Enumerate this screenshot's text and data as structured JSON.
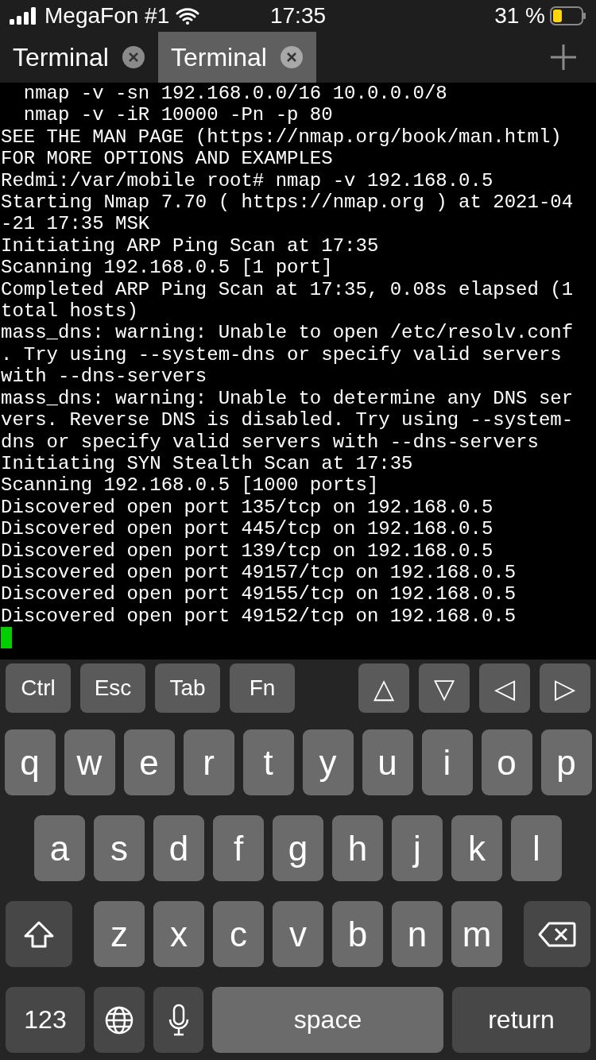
{
  "status_bar": {
    "carrier": "MegaFon #1",
    "time": "17:35",
    "battery": "31 %"
  },
  "tabs": [
    {
      "label": "Terminal",
      "selected": false
    },
    {
      "label": "Terminal",
      "selected": true
    }
  ],
  "terminal": {
    "lines": [
      "  nmap -v -sn 192.168.0.0/16 10.0.0.0/8",
      "  nmap -v -iR 10000 -Pn -p 80",
      "SEE THE MAN PAGE (https://nmap.org/book/man.html)",
      "FOR MORE OPTIONS AND EXAMPLES",
      "Redmi:/var/mobile root# nmap -v 192.168.0.5",
      "Starting Nmap 7.70 ( https://nmap.org ) at 2021-04",
      "-21 17:35 MSK",
      "Initiating ARP Ping Scan at 17:35",
      "Scanning 192.168.0.5 [1 port]",
      "Completed ARP Ping Scan at 17:35, 0.08s elapsed (1",
      "total hosts)",
      "mass_dns: warning: Unable to open /etc/resolv.conf",
      ". Try using --system-dns or specify valid servers",
      "with --dns-servers",
      "mass_dns: warning: Unable to determine any DNS ser",
      "vers. Reverse DNS is disabled. Try using --system-",
      "dns or specify valid servers with --dns-servers",
      "Initiating SYN Stealth Scan at 17:35",
      "Scanning 192.168.0.5 [1000 ports]",
      "Discovered open port 135/tcp on 192.168.0.5",
      "Discovered open port 445/tcp on 192.168.0.5",
      "Discovered open port 139/tcp on 192.168.0.5",
      "Discovered open port 49157/tcp on 192.168.0.5",
      "Discovered open port 49155/tcp on 192.168.0.5",
      "Discovered open port 49152/tcp on 192.168.0.5"
    ],
    "cursor": true
  },
  "accessory_keys": {
    "left": [
      "Ctrl",
      "Esc",
      "Tab",
      "Fn"
    ],
    "right": [
      "△",
      "▽",
      "◁",
      "▷"
    ]
  },
  "keyboard": [
    [
      {
        "kind": "letter",
        "label": "q"
      },
      {
        "kind": "letter",
        "label": "w"
      },
      {
        "kind": "letter",
        "label": "e"
      },
      {
        "kind": "letter",
        "label": "r"
      },
      {
        "kind": "letter",
        "label": "t"
      },
      {
        "kind": "letter",
        "label": "y"
      },
      {
        "kind": "letter",
        "label": "u"
      },
      {
        "kind": "letter",
        "label": "i"
      },
      {
        "kind": "letter",
        "label": "o"
      },
      {
        "kind": "letter",
        "label": "p"
      }
    ],
    [
      {
        "kind": "letter",
        "label": "a"
      },
      {
        "kind": "letter",
        "label": "s"
      },
      {
        "kind": "letter",
        "label": "d"
      },
      {
        "kind": "letter",
        "label": "f"
      },
      {
        "kind": "letter",
        "label": "g"
      },
      {
        "kind": "letter",
        "label": "h"
      },
      {
        "kind": "letter",
        "label": "j"
      },
      {
        "kind": "letter",
        "label": "k"
      },
      {
        "kind": "letter",
        "label": "l"
      }
    ],
    [
      {
        "kind": "shift"
      },
      {
        "kind": "letter",
        "label": "z"
      },
      {
        "kind": "letter",
        "label": "x"
      },
      {
        "kind": "letter",
        "label": "c"
      },
      {
        "kind": "letter",
        "label": "v"
      },
      {
        "kind": "letter",
        "label": "b"
      },
      {
        "kind": "letter",
        "label": "n"
      },
      {
        "kind": "letter",
        "label": "m"
      },
      {
        "kind": "backspace"
      }
    ],
    [
      {
        "kind": "mode",
        "label": "123"
      },
      {
        "kind": "globe"
      },
      {
        "kind": "mic"
      },
      {
        "kind": "space",
        "label": "space"
      },
      {
        "kind": "return",
        "label": "return"
      }
    ]
  ]
}
